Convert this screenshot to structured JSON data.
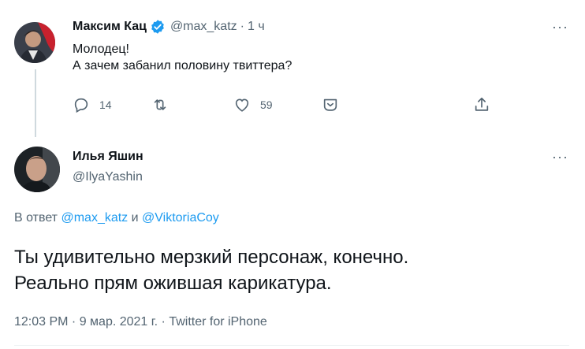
{
  "tweet1": {
    "author_name": "Максим Кац",
    "handle": "@max_katz",
    "separator": "·",
    "time": "1 ч",
    "line1": "Молодец!",
    "line2": "А зачем забанил половину твиттера?",
    "reply_count": "14",
    "like_count": "59",
    "verified": true
  },
  "tweet2": {
    "author_name": "Илья Яшин",
    "handle": "@IlyaYashin",
    "reply_prefix": "В ответ",
    "mention1": "@max_katz",
    "conj": "и",
    "mention2": "@ViktoriaCoy",
    "text_line1": "Ты удивительно мерзкий персонаж, конечно.",
    "text_line2": "Реально прям ожившая карикатура.",
    "meta": "12:03 PM · 9 мар. 2021 г. · Twitter for iPhone"
  },
  "more_glyph": "···",
  "colors": {
    "accent": "#1d9bf0",
    "secondary": "#536471",
    "text": "#0f1419"
  }
}
